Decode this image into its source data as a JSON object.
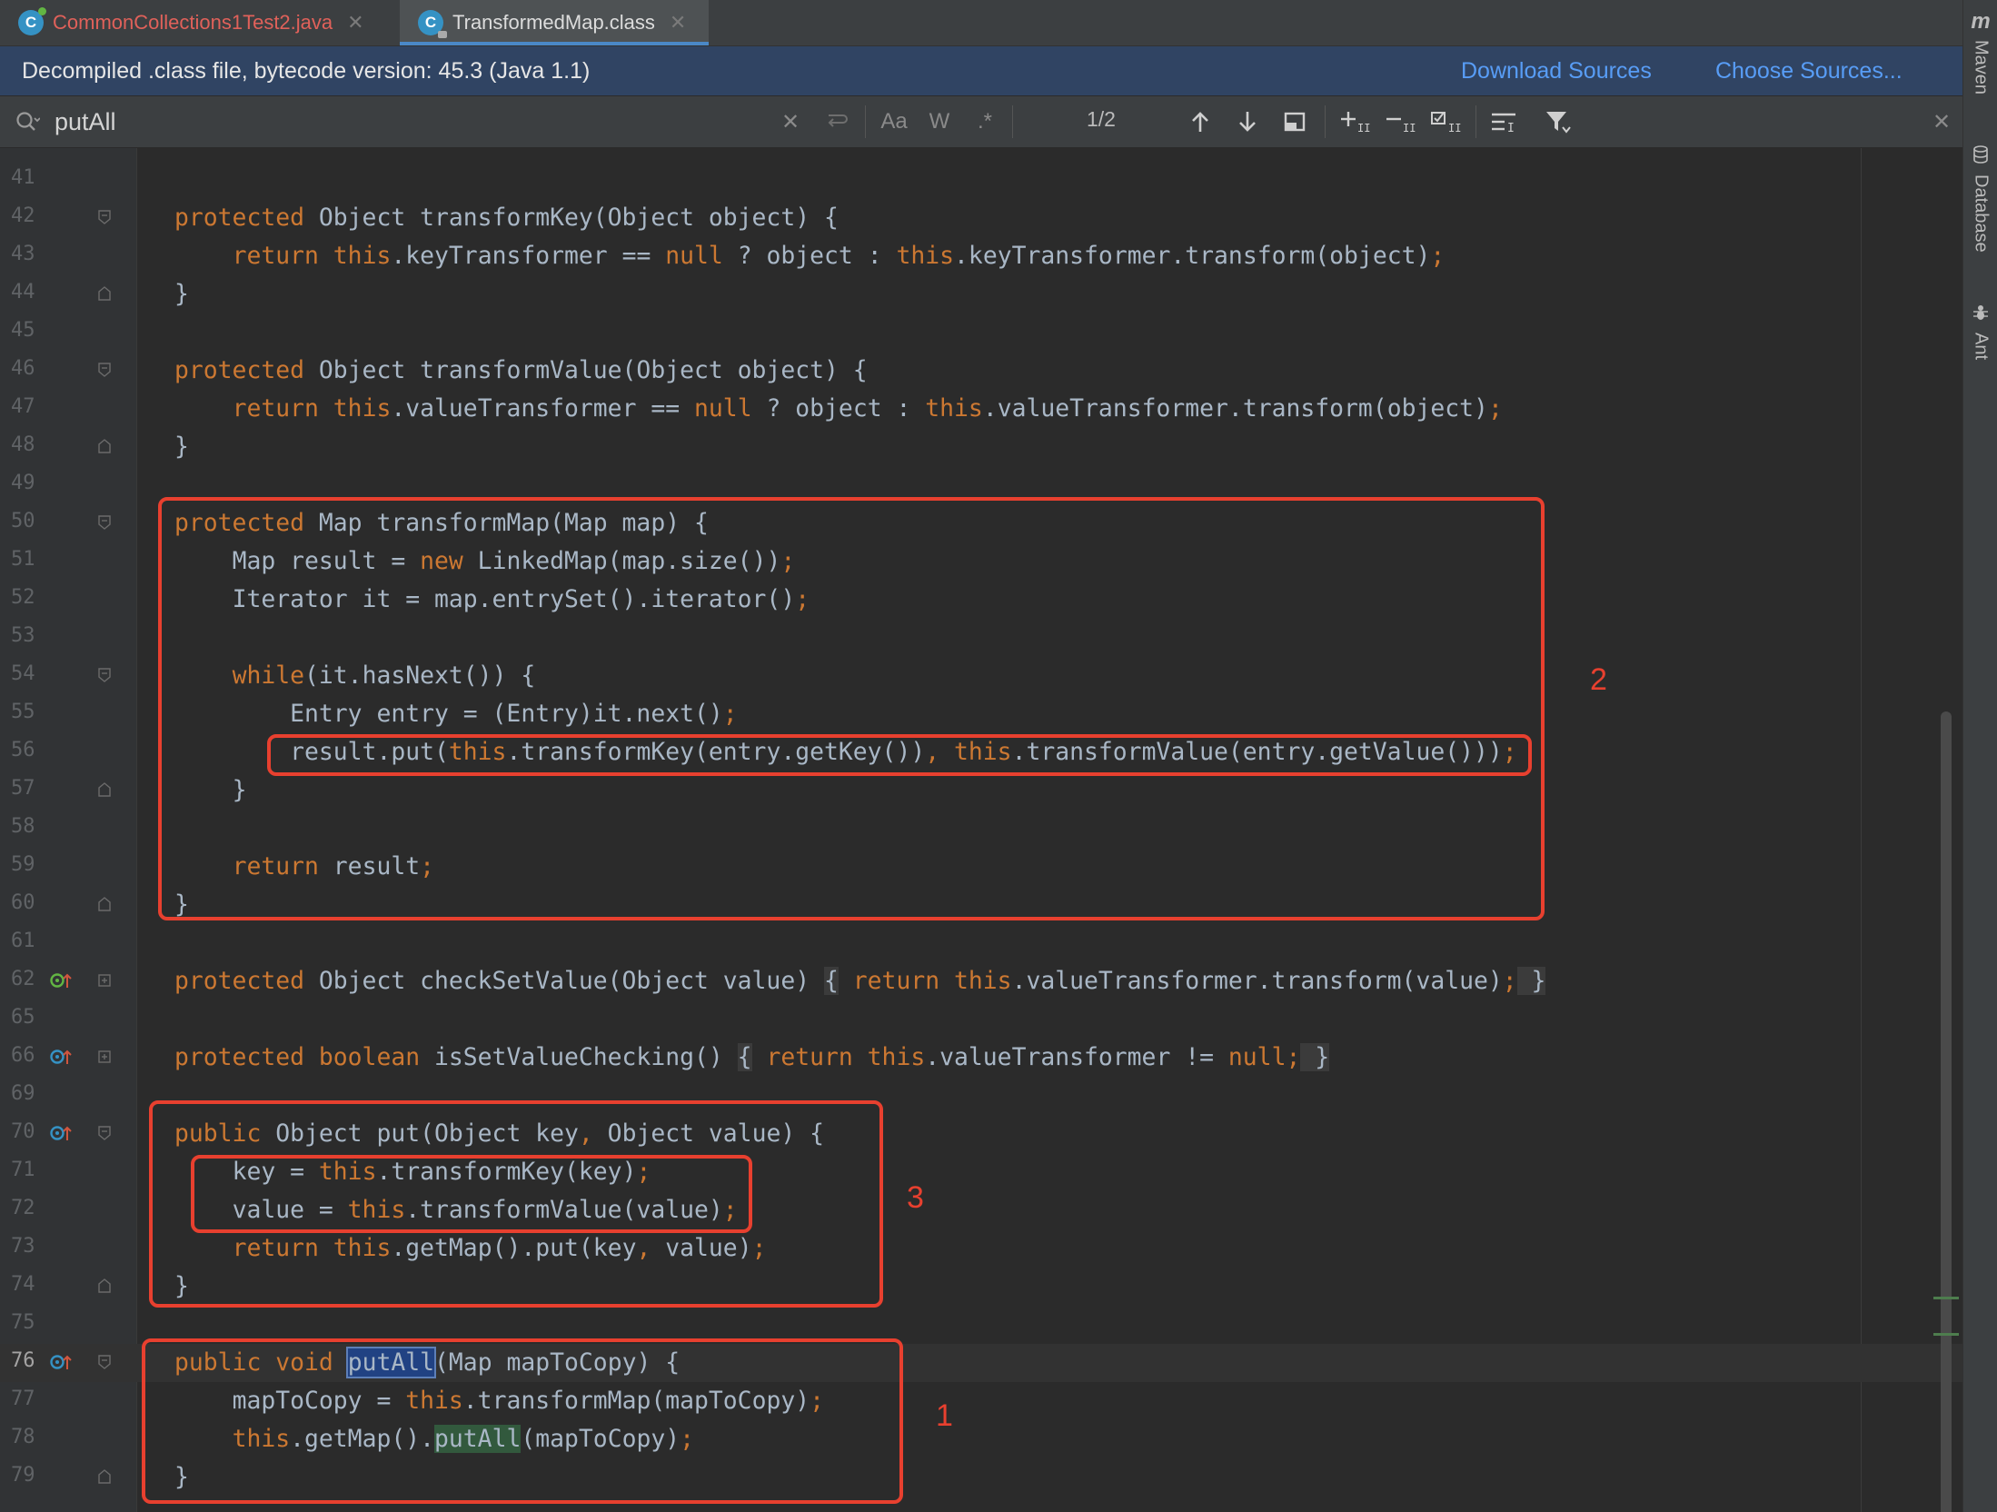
{
  "tabs": [
    {
      "label": "CommonCollections1Test2.java",
      "icon": "java-class-icon",
      "active": false
    },
    {
      "label": "TransformedMap.class",
      "icon": "compiled-class-icon",
      "active": true
    }
  ],
  "notification": {
    "text": "Decompiled .class file, bytecode version: 45.3 (Java 1.1)",
    "download_sources": "Download Sources",
    "choose_sources": "Choose Sources..."
  },
  "search": {
    "value": "putAll",
    "match_case": "Aa",
    "words": "W",
    "regex": ".*",
    "match_count": "1/2"
  },
  "right_toolbar": [
    {
      "label": "Maven",
      "icon": "maven-icon"
    },
    {
      "label": "Database",
      "icon": "database-icon"
    },
    {
      "label": "Ant",
      "icon": "ant-icon"
    }
  ],
  "annotations": {
    "label_1": "1",
    "label_2": "2",
    "label_3": "3"
  },
  "code": {
    "l41": {
      "num": "41"
    },
    "l42": {
      "num": "42",
      "kw": "protected",
      "t": " Object transformKey(Object object) {"
    },
    "l43": {
      "num": "43",
      "k1": "return",
      "k2": "this",
      "t1": ".keyTransformer == ",
      "k3": "null",
      "t2": " ? object : ",
      "k4": "this",
      "t3": ".keyTransformer.transform(object)",
      "k5": ";"
    },
    "l44": {
      "num": "44",
      "t": "}"
    },
    "l45": {
      "num": "45"
    },
    "l46": {
      "num": "46",
      "kw": "protected",
      "t": " Object transformValue(Object object) {"
    },
    "l47": {
      "num": "47",
      "k1": "return",
      "k2": "this",
      "t1": ".valueTransformer == ",
      "k3": "null",
      "t2": " ? object : ",
      "k4": "this",
      "t3": ".valueTransformer.transform(object)",
      "k5": ";"
    },
    "l48": {
      "num": "48",
      "t": "}"
    },
    "l49": {
      "num": "49"
    },
    "l50": {
      "num": "50",
      "kw": "protected",
      "t": " Map transformMap(Map map) {"
    },
    "l51": {
      "num": "51",
      "t1": "Map result = ",
      "k1": "new",
      "t2": " LinkedMap(map.size())",
      "k2": ";"
    },
    "l52": {
      "num": "52",
      "t1": "Iterator it = map.entrySet().iterator()",
      "k1": ";"
    },
    "l53": {
      "num": "53"
    },
    "l54": {
      "num": "54",
      "k1": "while",
      "t1": "(it.hasNext()) {"
    },
    "l55": {
      "num": "55",
      "t1": "Entry entry = (Entry)it.next()",
      "k1": ";"
    },
    "l56": {
      "num": "56",
      "t1": "result.put(",
      "k1": "this",
      "t2": ".transformKey(entry.getKey())",
      "k2": ", ",
      "k3": "this",
      "t3": ".transformValue(entry.getValue()))",
      "k4": ";"
    },
    "l57": {
      "num": "57",
      "t": "}"
    },
    "l58": {
      "num": "58"
    },
    "l59": {
      "num": "59",
      "k1": "return",
      "t1": " result",
      "k2": ";"
    },
    "l60": {
      "num": "60",
      "t": "}"
    },
    "l61": {
      "num": "61"
    },
    "l62": {
      "num": "62",
      "k1": "protected",
      "t1": " Object checkSetValue(Object value) ",
      "b1": "{",
      "k2": " return ",
      "k3": "this",
      "t2": ".valueTransformer.transform(value)",
      "k4": ";",
      "b2": " }"
    },
    "l65": {
      "num": "65"
    },
    "l66": {
      "num": "66",
      "k1": "protected",
      "k2": " boolean",
      "t1": " isSetValueChecking() ",
      "b1": "{",
      "k3": " return ",
      "k4": "this",
      "t2": ".valueTransformer != ",
      "k5": "null",
      "k6": ";",
      "b2": " }"
    },
    "l69": {
      "num": "69"
    },
    "l70": {
      "num": "70",
      "k1": "public",
      "t1": " Object put(Object key",
      "k2": ",",
      "t2": " Object value) {"
    },
    "l71": {
      "num": "71",
      "t1": "key = ",
      "k1": "this",
      "t2": ".transformKey(key)",
      "k2": ";"
    },
    "l72": {
      "num": "72",
      "t1": "value = ",
      "k1": "this",
      "t2": ".transformValue(value)",
      "k2": ";"
    },
    "l73": {
      "num": "73",
      "k1": "return",
      "k2": " this",
      "t1": ".getMap().put(key",
      "k3": ",",
      "t2": " value)",
      "k4": ";"
    },
    "l74": {
      "num": "74",
      "t": "}"
    },
    "l75": {
      "num": "75"
    },
    "l76": {
      "num": "76",
      "k1": "public",
      "k2": " void",
      "t0": " ",
      "hl": "putAll",
      "t1": "(Map mapToCopy) {"
    },
    "l77": {
      "num": "77",
      "t1": "mapToCopy = ",
      "k1": "this",
      "t2": ".transformMap(mapToCopy)",
      "k2": ";"
    },
    "l78": {
      "num": "78",
      "k1": "this",
      "t1": ".getMap().",
      "hl": "putAll",
      "t2": "(mapToCopy)",
      "k2": ";"
    },
    "l79": {
      "num": "79",
      "t": "}"
    }
  }
}
